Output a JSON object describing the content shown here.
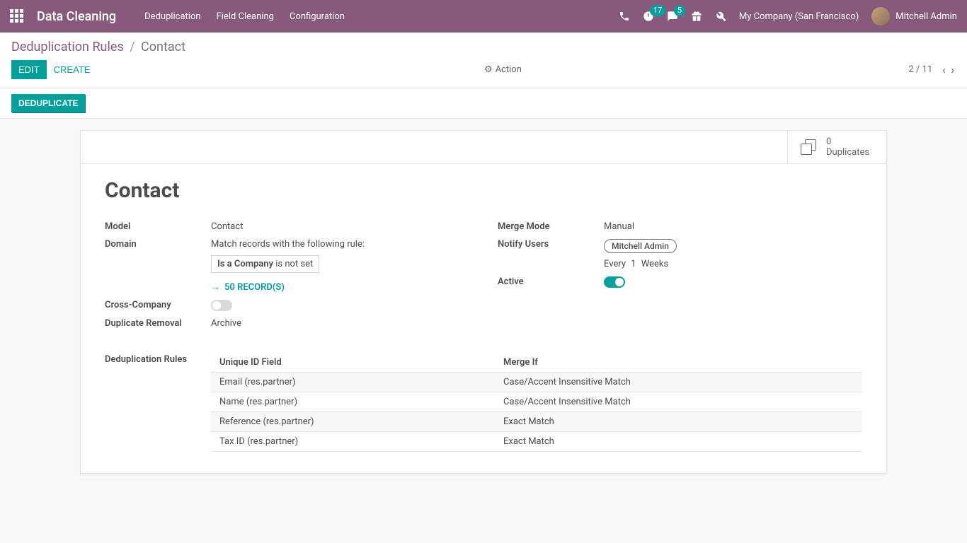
{
  "navbar": {
    "app_title": "Data Cleaning",
    "menu": [
      "Deduplication",
      "Field Cleaning",
      "Configuration"
    ],
    "badge_activities": "17",
    "badge_messages": "5",
    "company": "My Company (San Francisco)",
    "user": "Mitchell Admin"
  },
  "breadcrumb": {
    "parent": "Deduplication Rules",
    "current": "Contact"
  },
  "buttons": {
    "edit": "EDIT",
    "create": "CREATE",
    "action": "Action",
    "deduplicate": "DEDUPLICATE"
  },
  "pager": {
    "text": "2 / 11"
  },
  "stat_button": {
    "value": "0",
    "label": "Duplicates"
  },
  "record": {
    "title": "Contact",
    "labels": {
      "model": "Model",
      "domain": "Domain",
      "cross_company": "Cross-Company",
      "duplicate_removal": "Duplicate Removal",
      "merge_mode": "Merge Mode",
      "notify_users": "Notify Users",
      "active": "Active",
      "dedup_rules": "Deduplication Rules"
    },
    "model": "Contact",
    "domain_desc": "Match records with the following rule:",
    "domain_rule_field": "Is a Company",
    "domain_rule_op": "is not set",
    "records_link": "50 RECORD(S)",
    "duplicate_removal": "Archive",
    "merge_mode": "Manual",
    "notify_user_tag": "Mitchell Admin",
    "notify_every": "Every",
    "notify_num": "1",
    "notify_unit": "Weeks"
  },
  "rules_table": {
    "headers": {
      "field": "Unique ID Field",
      "merge_if": "Merge If"
    },
    "rows": [
      {
        "field": "Email (res.partner)",
        "merge_if": "Case/Accent Insensitive Match"
      },
      {
        "field": "Name (res.partner)",
        "merge_if": "Case/Accent Insensitive Match"
      },
      {
        "field": "Reference (res.partner)",
        "merge_if": "Exact Match"
      },
      {
        "field": "Tax ID (res.partner)",
        "merge_if": "Exact Match"
      }
    ]
  }
}
